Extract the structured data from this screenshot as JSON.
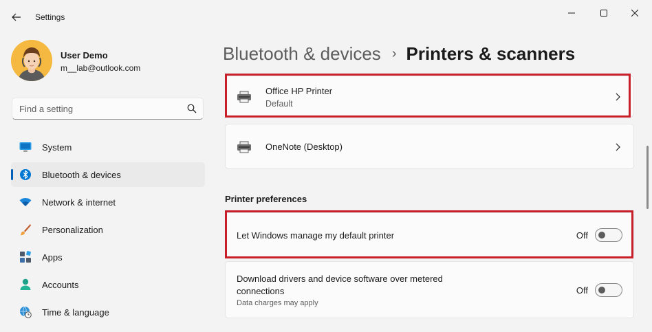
{
  "app": {
    "title": "Settings"
  },
  "user": {
    "name": "User Demo",
    "email": "m__lab@outlook.com"
  },
  "search": {
    "placeholder": "Find a setting",
    "value": ""
  },
  "nav": [
    {
      "label": "System",
      "icon": "system-icon",
      "active": false
    },
    {
      "label": "Bluetooth & devices",
      "icon": "bluetooth-icon",
      "active": true
    },
    {
      "label": "Network & internet",
      "icon": "wifi-icon",
      "active": false
    },
    {
      "label": "Personalization",
      "icon": "brush-icon",
      "active": false
    },
    {
      "label": "Apps",
      "icon": "apps-icon",
      "active": false
    },
    {
      "label": "Accounts",
      "icon": "accounts-icon",
      "active": false
    },
    {
      "label": "Time & language",
      "icon": "globe-clock-icon",
      "active": false
    }
  ],
  "breadcrumb": {
    "parent": "Bluetooth & devices",
    "separator": "›",
    "current": "Printers & scanners"
  },
  "printers": [
    {
      "name": "Office HP Printer",
      "status": "Default",
      "icon": "printer-icon"
    },
    {
      "name": "OneNote (Desktop)",
      "status": "",
      "icon": "printer-icon"
    }
  ],
  "preferences": {
    "title": "Printer preferences",
    "items": [
      {
        "label": "Let Windows manage my default printer",
        "description": "",
        "state": "Off"
      },
      {
        "label": "Download drivers and device software over metered connections",
        "description": "Data charges may apply",
        "state": "Off"
      }
    ]
  },
  "colors": {
    "accent": "#005fb8",
    "highlight": "#c8202a",
    "background": "#f3f3f3",
    "card": "#fbfbfb"
  }
}
